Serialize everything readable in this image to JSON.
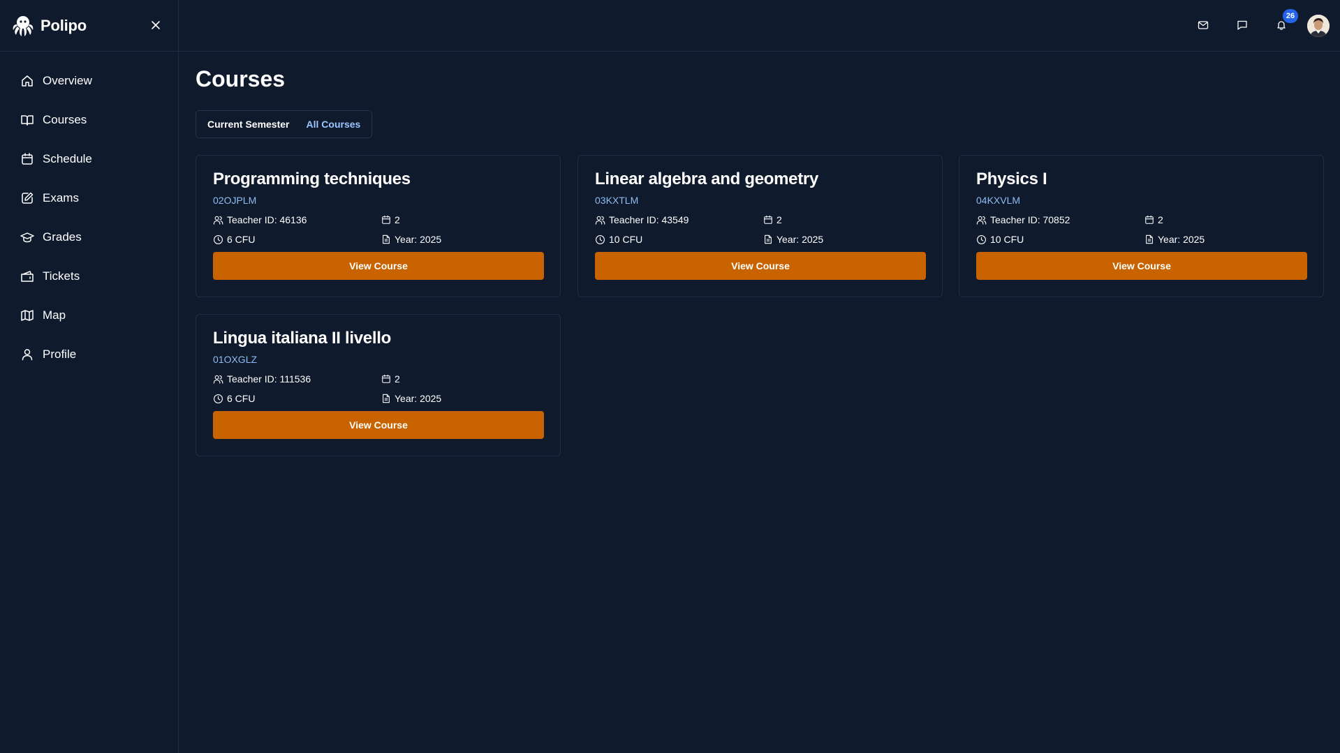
{
  "app": {
    "name": "Polipo"
  },
  "sidebar": {
    "items": [
      {
        "label": "Overview",
        "icon": "home-icon"
      },
      {
        "label": "Courses",
        "icon": "book-icon"
      },
      {
        "label": "Schedule",
        "icon": "calendar-icon"
      },
      {
        "label": "Exams",
        "icon": "edit-document-icon"
      },
      {
        "label": "Grades",
        "icon": "graduation-cap-icon"
      },
      {
        "label": "Tickets",
        "icon": "ticket-icon"
      },
      {
        "label": "Map",
        "icon": "map-icon"
      },
      {
        "label": "Profile",
        "icon": "user-icon"
      }
    ]
  },
  "topbar": {
    "notifications_count": "26",
    "icons": [
      "mail-icon",
      "message-icon",
      "bell-icon"
    ]
  },
  "page": {
    "title": "Courses",
    "tabs": [
      {
        "label": "Current Semester",
        "active": true
      },
      {
        "label": "All Courses",
        "active": false
      }
    ]
  },
  "courses": [
    {
      "title": "Programming techniques",
      "code": "02OJPLM",
      "teacher": "Teacher ID: 46136",
      "period": "2",
      "credits": "6 CFU",
      "year": "Year: 2025",
      "button": "View Course"
    },
    {
      "title": "Linear algebra and geometry",
      "code": "03KXTLM",
      "teacher": "Teacher ID: 43549",
      "period": "2",
      "credits": "10 CFU",
      "year": "Year: 2025",
      "button": "View Course"
    },
    {
      "title": "Physics I",
      "code": "04KXVLM",
      "teacher": "Teacher ID: 70852",
      "period": "2",
      "credits": "10 CFU",
      "year": "Year: 2025",
      "button": "View Course"
    },
    {
      "title": "Lingua italiana II livello",
      "code": "01OXGLZ",
      "teacher": "Teacher ID: 111536",
      "period": "2",
      "credits": "6 CFU",
      "year": "Year: 2025",
      "button": "View Course"
    }
  ],
  "colors": {
    "background": "#0f1b2d",
    "accent_button": "#c96300",
    "link": "#9cc6ff",
    "badge": "#2563eb"
  }
}
